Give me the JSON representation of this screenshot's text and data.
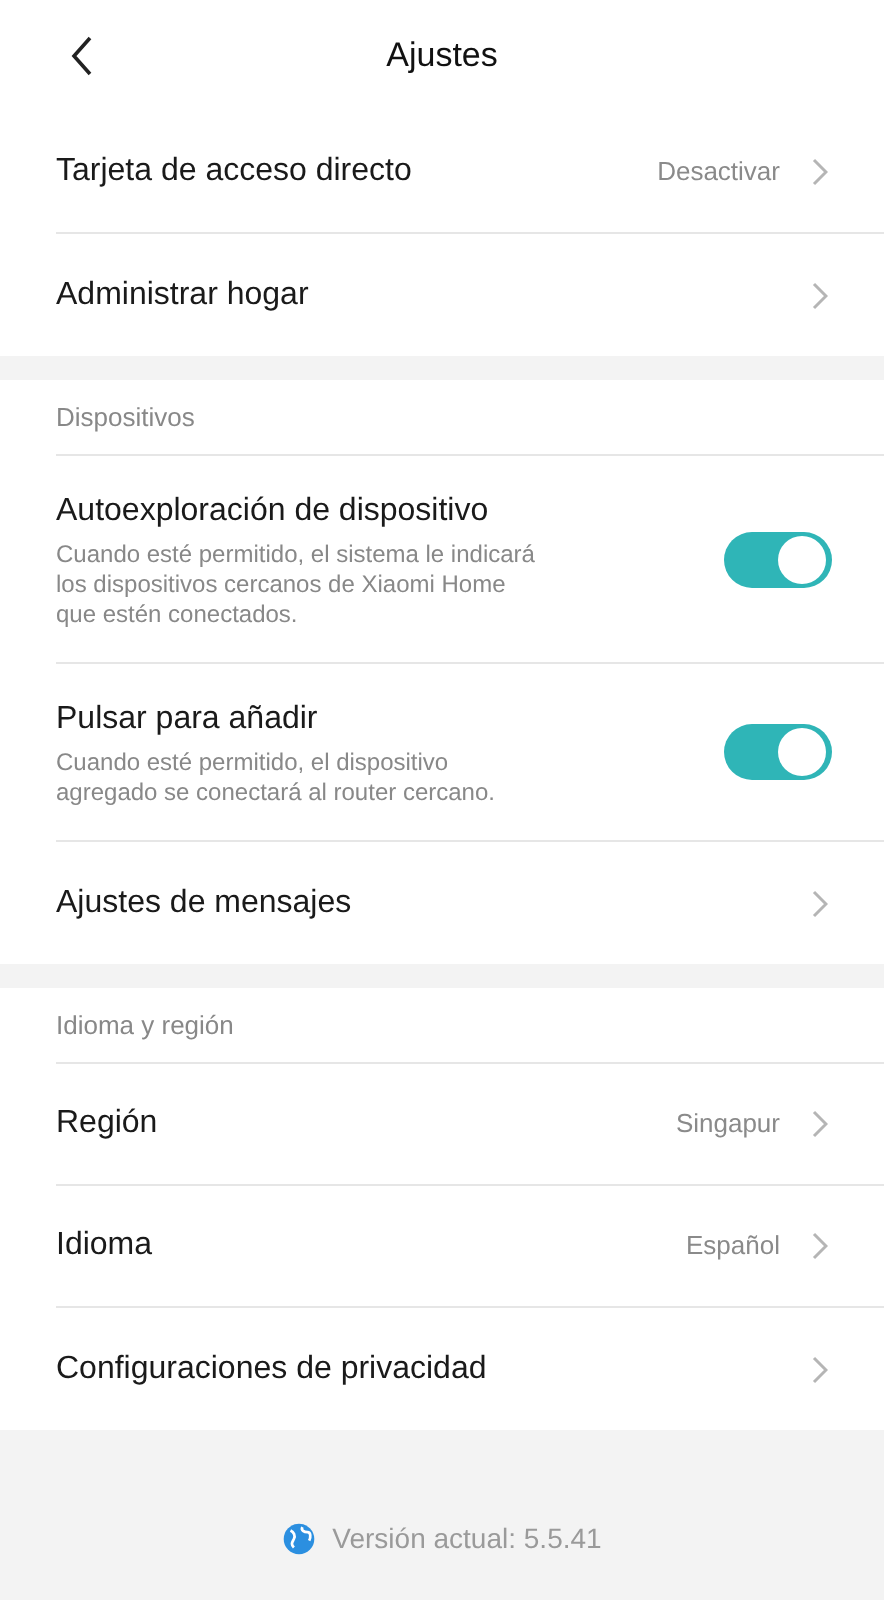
{
  "header": {
    "title": "Ajustes"
  },
  "groups": [
    {
      "items": [
        {
          "kind": "link",
          "label": "Tarjeta de acceso directo",
          "value": "Desactivar"
        },
        {
          "kind": "link",
          "label": "Administrar hogar"
        }
      ]
    },
    {
      "heading": "Dispositivos",
      "items": [
        {
          "kind": "toggle",
          "label": "Autoexploración de dispositivo",
          "description": "Cuando esté permitido, el sistema le indicará los dispositivos cercanos de Xiaomi Home que estén conectados.",
          "on": true
        },
        {
          "kind": "toggle",
          "label": "Pulsar para añadir",
          "description": "Cuando esté permitido, el dispositivo agregado se conectará al router cercano.",
          "on": true
        },
        {
          "kind": "link",
          "label": "Ajustes de mensajes"
        }
      ]
    },
    {
      "heading": "Idioma y región",
      "items": [
        {
          "kind": "link",
          "label": "Región",
          "value": "Singapur"
        },
        {
          "kind": "link",
          "label": "Idioma",
          "value": "Español"
        },
        {
          "kind": "link",
          "label": "Configuraciones de privacidad"
        }
      ]
    }
  ],
  "footer": {
    "version": "Versión actual: 5.5.41"
  }
}
